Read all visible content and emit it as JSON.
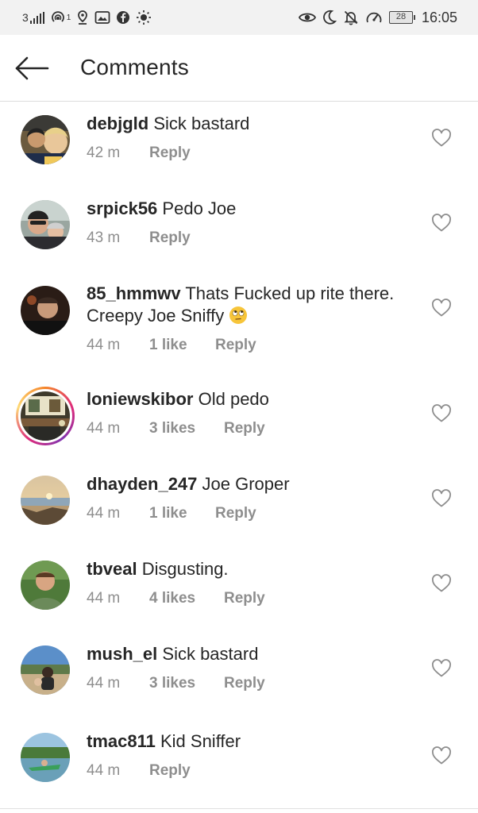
{
  "status_bar": {
    "network": "3",
    "hotspot_count": "1",
    "battery": "28",
    "time": "16:05",
    "icons_left": [
      "signal-icon",
      "hotspot-icon",
      "location-icon",
      "gallery-icon",
      "facebook-icon",
      "brightness-icon"
    ],
    "icons_right": [
      "eye-icon",
      "moon-icon",
      "bell-off-icon",
      "speed-icon",
      "battery-icon"
    ]
  },
  "header": {
    "back_icon": "arrow-left-icon",
    "title": "Comments"
  },
  "comments": [
    {
      "username": "debjgld",
      "text": "Sick bastard",
      "time": "42 m",
      "likes": "",
      "reply": "Reply"
    },
    {
      "username": "srpick56",
      "text": "Pedo Joe",
      "time": "43 m",
      "likes": "",
      "reply": "Reply"
    },
    {
      "username": "85_hmmwv",
      "text": "Thats Fucked up rite there. Creepy Joe Sniffy",
      "emoji": "face-with-rolling-eyes",
      "time": "44 m",
      "likes": "1 like",
      "reply": "Reply"
    },
    {
      "username": "loniewskibor",
      "text": "Old pedo",
      "time": "44 m",
      "likes": "3 likes",
      "reply": "Reply",
      "has_story": true
    },
    {
      "username": "dhayden_247",
      "text": "Joe Groper",
      "time": "44 m",
      "likes": "1 like",
      "reply": "Reply"
    },
    {
      "username": "tbveal",
      "text": "Disgusting.",
      "time": "44 m",
      "likes": "4 likes",
      "reply": "Reply"
    },
    {
      "username": "mush_el",
      "text": "Sick bastard",
      "time": "44 m",
      "likes": "3 likes",
      "reply": "Reply"
    },
    {
      "username": "tmac811",
      "text": "Kid Sniffer",
      "time": "44 m",
      "likes": "",
      "reply": "Reply"
    }
  ],
  "colors": {
    "text": "#262626",
    "secondary": "#8e8e8e",
    "status_bar_bg": "#f2f2f2",
    "story_ring": "#dd2a7b"
  }
}
